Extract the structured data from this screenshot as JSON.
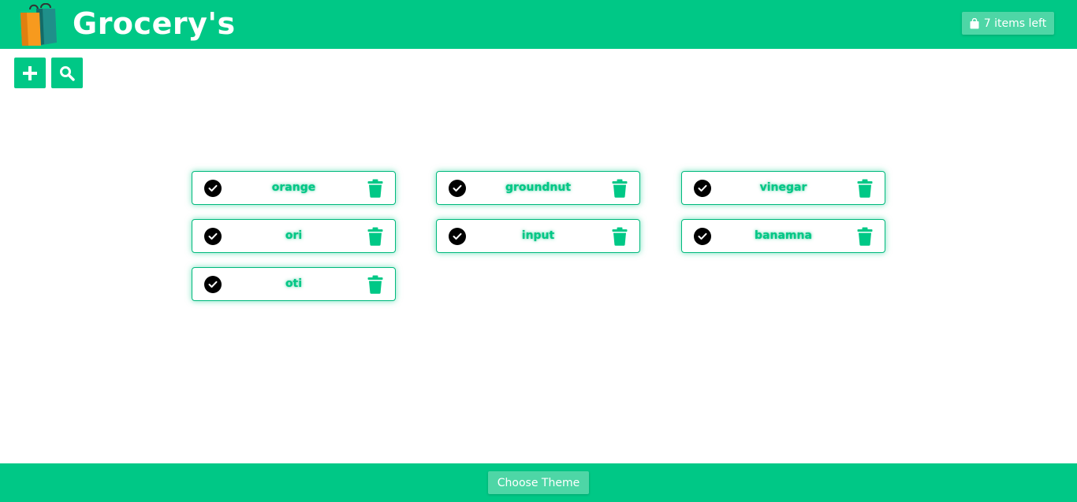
{
  "header": {
    "title": "Grocery's",
    "logo_icon": "shopping-bags-icon",
    "items_left_label": "7 items left",
    "items_left_icon": "shopping-bag-icon"
  },
  "toolbar": {
    "add_icon": "plus-icon",
    "search_icon": "search-icon"
  },
  "items": [
    {
      "name": "orange"
    },
    {
      "name": "groundnut"
    },
    {
      "name": "vinegar"
    },
    {
      "name": "ori"
    },
    {
      "name": "input"
    },
    {
      "name": "banamna"
    },
    {
      "name": "oti"
    }
  ],
  "footer": {
    "theme_button_label": "Choose Theme"
  },
  "colors": {
    "accent": "#00c886",
    "button_light": "#4ed6a6",
    "check": "#000000"
  }
}
